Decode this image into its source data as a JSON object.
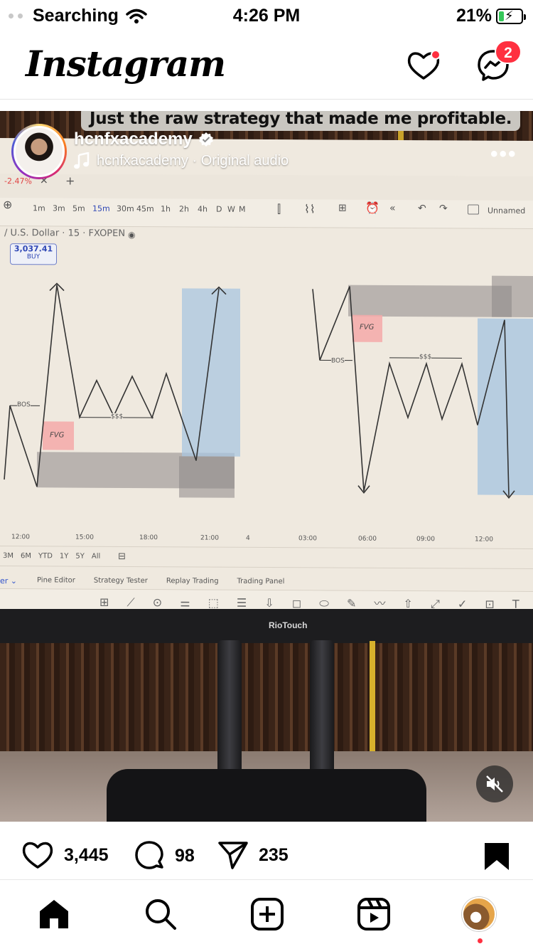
{
  "status_bar": {
    "carrier": "Searching",
    "time": "4:26 PM",
    "battery": "21%"
  },
  "header": {
    "logo": "Instagram",
    "message_badge": "2"
  },
  "post": {
    "caption_overlay": "Just the raw strategy that made me profitable.",
    "username": "hcnfxacademy",
    "audio": "hcnfxacademy · Original audio",
    "chart_screen": {
      "change": "-2.47%",
      "timeframes": [
        "1m",
        "3m",
        "5m",
        "15m",
        "30m",
        "45m",
        "1h",
        "2h",
        "4h",
        "D",
        "W",
        "M"
      ],
      "symbol": "/ U.S. Dollar · 15 · FXOPEN",
      "price": "3,037.41",
      "buy": "BUY",
      "layout_name": "Unnamed",
      "labels": {
        "bos_left": "BOS",
        "fvg_left": "FVG",
        "sss_left": "$$$",
        "bos_right": "BOS",
        "fvg_right": "FVG",
        "sss_right": "$$$"
      },
      "time_axis": [
        "12:00",
        "15:00",
        "18:00",
        "21:00",
        "4",
        "03:00",
        "06:00",
        "09:00",
        "12:00"
      ],
      "ranges": [
        "3M",
        "6M",
        "YTD",
        "1Y",
        "5Y",
        "All"
      ],
      "bottom_tabs": [
        "Pine Editor",
        "Strategy Tester",
        "Replay Trading",
        "Trading Panel"
      ],
      "monitor_brand": "RioTouch"
    }
  },
  "actions": {
    "likes": "3,445",
    "comments": "98",
    "shares": "235"
  }
}
